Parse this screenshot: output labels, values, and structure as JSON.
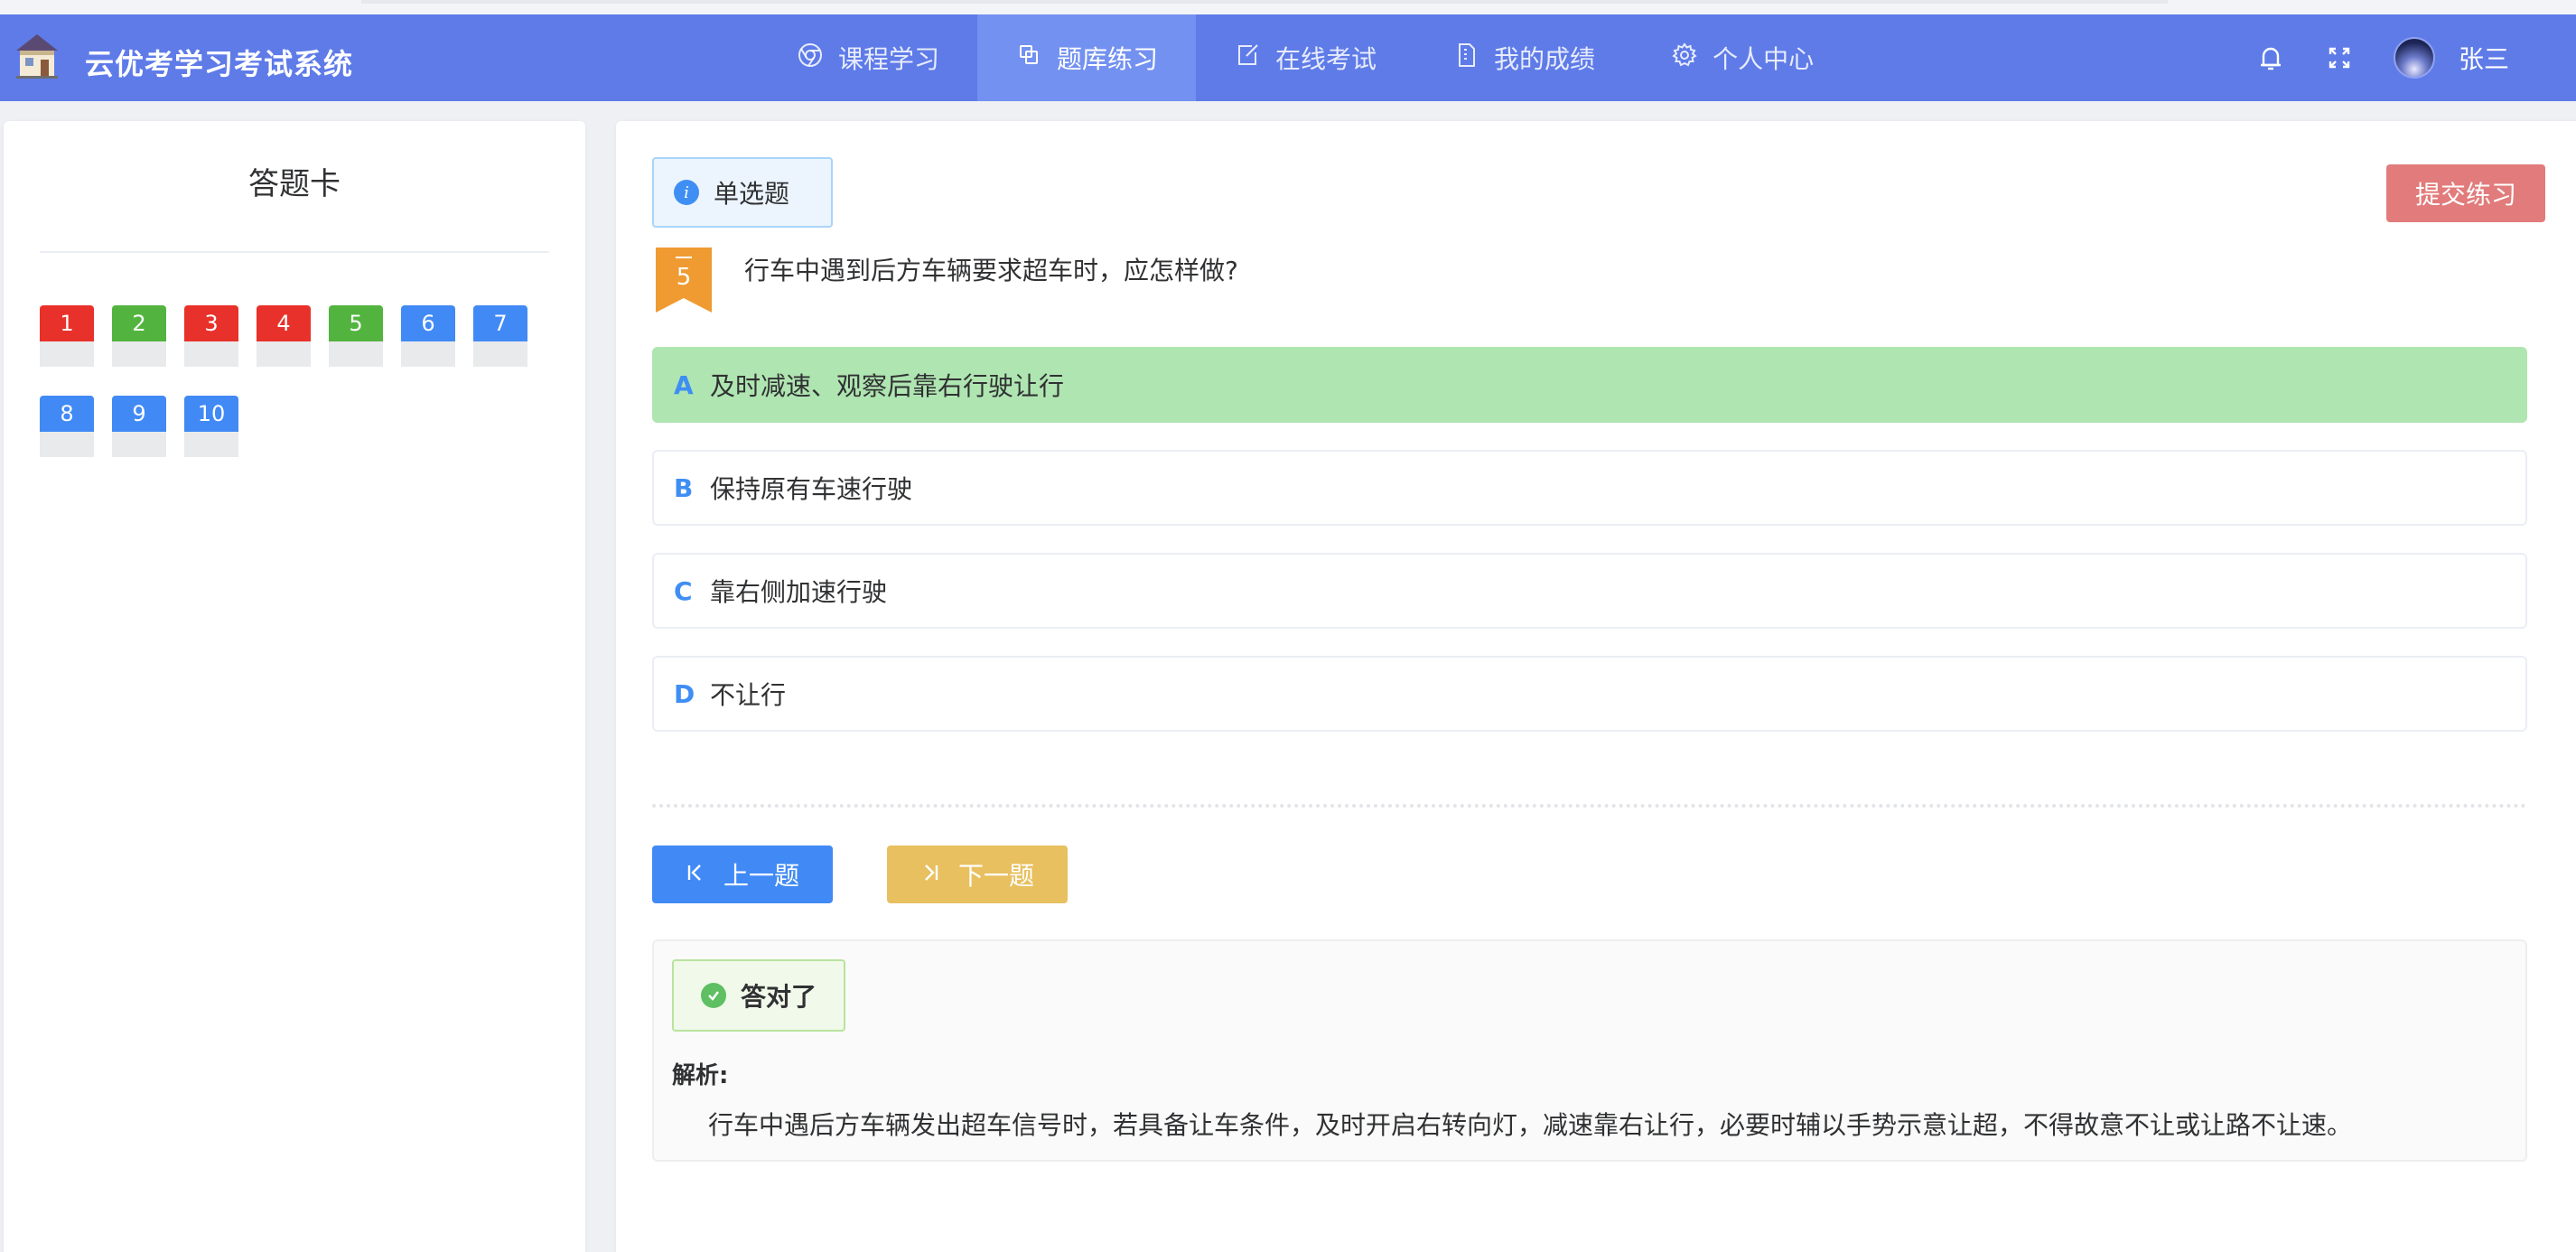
{
  "app": {
    "title": "云优考学习考试系统"
  },
  "nav": {
    "items": [
      {
        "label": "课程学习",
        "icon": "chrome-icon",
        "active": false
      },
      {
        "label": "题库练习",
        "icon": "copy-icon",
        "active": true
      },
      {
        "label": "在线考试",
        "icon": "edit-icon",
        "active": false
      },
      {
        "label": "我的成绩",
        "icon": "document-icon",
        "active": false
      },
      {
        "label": "个人中心",
        "icon": "gear-icon",
        "active": false
      }
    ]
  },
  "user": {
    "name": "张三"
  },
  "answer_card": {
    "title": "答题卡",
    "questions": [
      {
        "num": "1",
        "status": "wrong"
      },
      {
        "num": "2",
        "status": "right"
      },
      {
        "num": "3",
        "status": "wrong"
      },
      {
        "num": "4",
        "status": "wrong"
      },
      {
        "num": "5",
        "status": "right"
      },
      {
        "num": "6",
        "status": "unanswered"
      },
      {
        "num": "7",
        "status": "unanswered"
      },
      {
        "num": "8",
        "status": "unanswered"
      },
      {
        "num": "9",
        "status": "unanswered"
      },
      {
        "num": "10",
        "status": "unanswered"
      }
    ]
  },
  "question": {
    "type_label": "单选题",
    "number": "5",
    "text": "行车中遇到后方车辆要求超车时，应怎样做?",
    "options": [
      {
        "letter": "A",
        "text": "及时减速、观察后靠右行驶让行",
        "correct": true
      },
      {
        "letter": "B",
        "text": "保持原有车速行驶",
        "correct": false
      },
      {
        "letter": "C",
        "text": "靠右侧加速行驶",
        "correct": false
      },
      {
        "letter": "D",
        "text": "不让行",
        "correct": false
      }
    ]
  },
  "actions": {
    "submit_label": "提交练习",
    "prev_label": "上一题",
    "next_label": "下一题"
  },
  "result": {
    "status_label": "答对了",
    "analysis_label": "解析:",
    "analysis_text": "行车中遇后方车辆发出超车信号时，若具备让车条件，及时开启右转向灯，减速靠右让行，必要时辅以手势示意让超，不得故意不让或让路不让速。"
  },
  "colors": {
    "header": "#5e7be8",
    "wrong": "#e8312a",
    "right": "#52b43f",
    "unanswered": "#418af5",
    "correct_option": "#afe5b1",
    "submit": "#e27b7b",
    "next": "#e8c060"
  }
}
